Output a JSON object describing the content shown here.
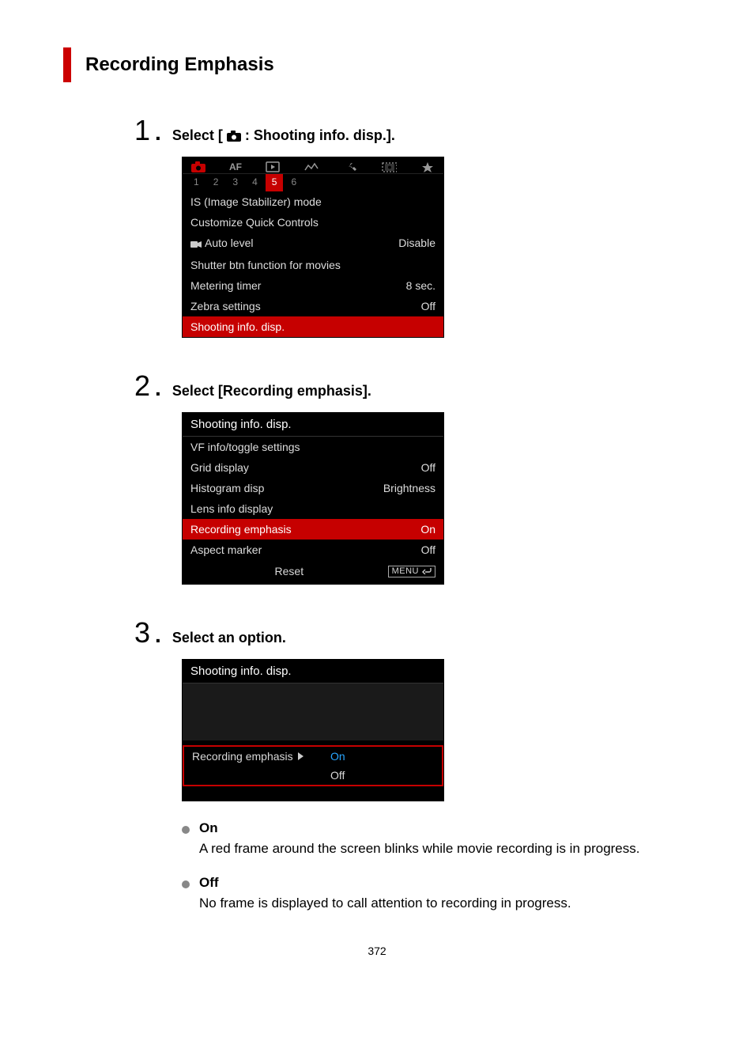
{
  "page": {
    "title": "Recording Emphasis",
    "number": "372",
    "steps": [
      {
        "num": "1",
        "text_pre": "Select [",
        "text_post": ": Shooting info. disp.]."
      },
      {
        "num": "2",
        "text": "Select [Recording emphasis]."
      },
      {
        "num": "3",
        "text": "Select an option."
      }
    ],
    "bullets": [
      {
        "title": "On",
        "desc": "A red frame around the screen blinks while movie recording is in progress."
      },
      {
        "title": "Off",
        "desc": "No frame is displayed to call attention to recording in progress."
      }
    ]
  },
  "menu1": {
    "subtabs": [
      "1",
      "2",
      "3",
      "4",
      "5",
      "6"
    ],
    "active_subtab": "5",
    "items": [
      {
        "label": "IS (Image Stabilizer) mode",
        "value": ""
      },
      {
        "label": "Customize Quick Controls",
        "value": ""
      },
      {
        "label": "Auto level",
        "value": "Disable",
        "icon": "movie"
      },
      {
        "label": "Shutter btn function for movies",
        "value": ""
      },
      {
        "label": "Metering timer",
        "value": "8 sec."
      },
      {
        "label": "Zebra settings",
        "value": "Off"
      },
      {
        "label": "Shooting info. disp.",
        "value": "",
        "sel": true
      }
    ]
  },
  "menu2": {
    "header": "Shooting info. disp.",
    "items": [
      {
        "label": "VF info/toggle settings",
        "value": ""
      },
      {
        "label": "Grid display",
        "value": "Off"
      },
      {
        "label": "Histogram disp",
        "value": "Brightness"
      },
      {
        "label": "Lens info display",
        "value": ""
      },
      {
        "label": "Recording emphasis",
        "value": "On",
        "sel": true
      },
      {
        "label": "Aspect marker",
        "value": "Off"
      }
    ],
    "reset": "Reset",
    "menu_label": "MENU"
  },
  "menu3": {
    "header": "Shooting info. disp.",
    "setting_label": "Recording emphasis",
    "options": [
      {
        "label": "On",
        "selected": true
      },
      {
        "label": "Off",
        "selected": false
      }
    ]
  }
}
